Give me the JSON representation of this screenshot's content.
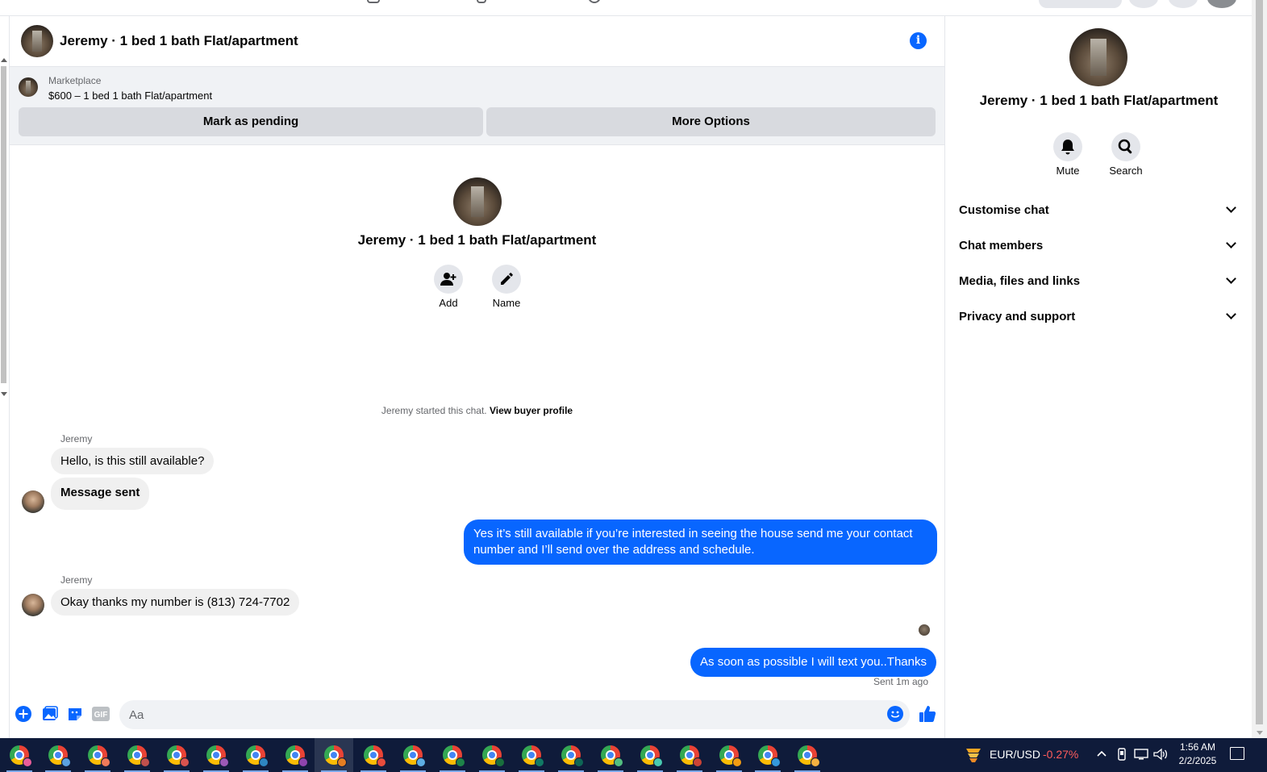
{
  "chat": {
    "title": "Jeremy · 1 bed 1 bath Flat/apartment",
    "info_icon": "i",
    "listing": {
      "label": "Marketplace",
      "price_line": "$600 – 1 bed 1 bath Flat/apartment",
      "mark_pending": "Mark as pending",
      "more_options": "More Options"
    },
    "intro": {
      "title": "Jeremy · 1 bed 1 bath Flat/apartment",
      "add_label": "Add",
      "name_label": "Name"
    },
    "started_text": "Jeremy started this chat.",
    "view_buyer_profile": "View buyer profile",
    "messages": [
      {
        "sender": "Jeremy",
        "text": "Hello, is this still available?"
      },
      {
        "text": "Message sent"
      },
      {
        "text": "Yes it’s still available if you’re interested in seeing the house send me your contact number and I’ll send over the address and schedule."
      },
      {
        "sender": "Jeremy",
        "text": "Okay thanks my number is (813) 724-7702"
      },
      {
        "text": "As soon as possible I will text you..Thanks"
      }
    ],
    "sent_status": "Sent 1m ago",
    "composer": {
      "placeholder": "Aa",
      "gif_label": "GIF"
    }
  },
  "panel": {
    "title": "Jeremy · 1 bed 1 bath Flat/apartment",
    "mute_label": "Mute",
    "search_label": "Search",
    "sections": [
      "Customise chat",
      "Chat members",
      "Media, files and links",
      "Privacy and support"
    ]
  },
  "taskbar": {
    "ticker_name": "EUR/USD",
    "ticker_change": "-0.27%",
    "time": "1:56 AM",
    "date": "2/2/2025"
  },
  "colors": {
    "accent": "#0866ff",
    "bubble_in": "#f0f0f0",
    "taskbar": "#0f1b3a",
    "ticker_negative": "#ff5c5c"
  },
  "icons": {
    "composer": [
      "plus-icon",
      "photo-icon",
      "sticker-icon",
      "gif-icon",
      "emoji-icon",
      "like-icon"
    ],
    "panel": [
      "bell-icon",
      "search-icon"
    ],
    "intro": [
      "add-person-icon",
      "pencil-icon"
    ]
  }
}
